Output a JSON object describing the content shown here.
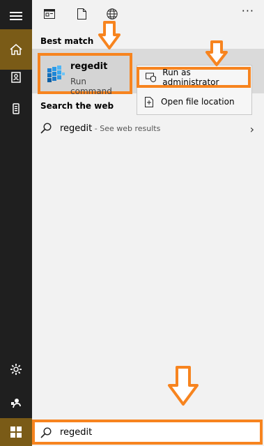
{
  "rail": {
    "items": [
      "hamburger-menu-icon",
      "home-icon",
      "documents-icon",
      "phone-icon",
      "settings-icon",
      "feedback-icon",
      "windows-start-icon"
    ]
  },
  "topbar": {
    "icons": [
      "document-view-icon",
      "file-icon",
      "globe-icon"
    ],
    "more": "···"
  },
  "best_match": {
    "heading": "Best match",
    "name": "regedit",
    "subtitle": "Run command"
  },
  "context_menu": {
    "run_admin": "Run as administrator",
    "open_location": "Open file location"
  },
  "web": {
    "heading": "Search the web",
    "term": "regedit",
    "hint": " - See web results"
  },
  "search": {
    "value": "regedit"
  },
  "colors": {
    "accent": "#f7841f",
    "rail_bg": "#1f1f1f",
    "rail_active": "#7a5b17"
  }
}
